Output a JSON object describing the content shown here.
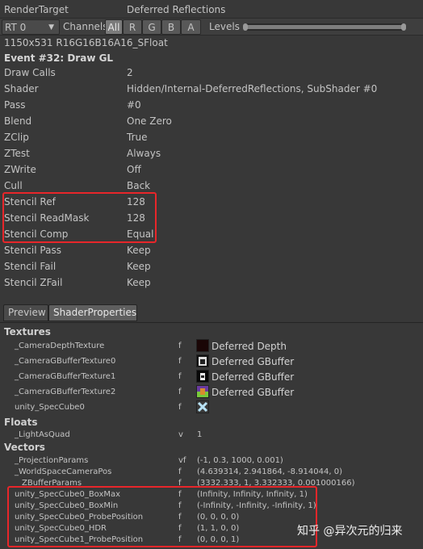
{
  "header": {
    "label": "RenderTarget",
    "value": "Deferred Reflections"
  },
  "toolbar": {
    "rt_value": "RT 0",
    "channels_label": "Channels",
    "channels": [
      "All",
      "R",
      "G",
      "B",
      "A"
    ],
    "levels_label": "Levels"
  },
  "format": "1150x531 R16G16B16A16_SFloat",
  "event_title": "Event #32: Draw GL",
  "properties": [
    {
      "label": "Draw Calls",
      "value": "2"
    },
    {
      "label": "Shader",
      "value": "Hidden/Internal-DeferredReflections, SubShader #0"
    },
    {
      "label": "Pass",
      "value": "#0"
    },
    {
      "label": "Blend",
      "value": "One Zero"
    },
    {
      "label": "ZClip",
      "value": "True"
    },
    {
      "label": "ZTest",
      "value": "Always"
    },
    {
      "label": "ZWrite",
      "value": "Off"
    },
    {
      "label": "Cull",
      "value": "Back"
    },
    {
      "label": "Stencil Ref",
      "value": "128"
    },
    {
      "label": "Stencil ReadMask",
      "value": "128"
    },
    {
      "label": "Stencil Comp",
      "value": "Equal"
    },
    {
      "label": "Stencil Pass",
      "value": "Keep"
    },
    {
      "label": "Stencil Fail",
      "value": "Keep"
    },
    {
      "label": "Stencil ZFail",
      "value": "Keep"
    }
  ],
  "tabs": [
    "Preview",
    "ShaderProperties"
  ],
  "textures_header": "Textures",
  "textures": [
    {
      "name": "_CameraDepthTexture",
      "flag": "f",
      "tex": "Deferred Depth"
    },
    {
      "name": "_CameraGBufferTexture0",
      "flag": "f",
      "tex": "Deferred GBuffer"
    },
    {
      "name": "_CameraGBufferTexture1",
      "flag": "f",
      "tex": "Deferred GBuffer"
    },
    {
      "name": "_CameraGBufferTexture2",
      "flag": "f",
      "tex": "Deferred GBuffer"
    },
    {
      "name": "unity_SpecCube0",
      "flag": "f",
      "tex": ""
    }
  ],
  "floats_header": "Floats",
  "floats": [
    {
      "name": "_LightAsQuad",
      "flag": "v",
      "value": "1"
    }
  ],
  "vectors_header": "Vectors",
  "vectors": [
    {
      "name": "_ProjectionParams",
      "flag": "vf",
      "value": "(-1, 0.3, 1000, 0.001)"
    },
    {
      "name": "_WorldSpaceCameraPos",
      "flag": "f",
      "value": "(4.639314, 2.941864, -8.914044, 0)"
    },
    {
      "name": "_ZBufferParams",
      "flag": "f",
      "value": "(3332.333, 1, 3.332333, 0.001000166)"
    },
    {
      "name": "unity_SpecCube0_BoxMax",
      "flag": "f",
      "value": "(Infinity, Infinity, Infinity, 1)"
    },
    {
      "name": "unity_SpecCube0_BoxMin",
      "flag": "f",
      "value": "(-Infinity, -Infinity, -Infinity, 1)"
    },
    {
      "name": "unity_SpecCube0_ProbePosition",
      "flag": "f",
      "value": "(0, 0, 0, 0)"
    },
    {
      "name": "unity_SpecCube0_HDR",
      "flag": "f",
      "value": "(1, 1, 0, 0)"
    },
    {
      "name": "unity_SpecCube1_ProbePosition",
      "flag": "f",
      "value": "(0, 0, 0, 1)"
    }
  ],
  "watermark": "知乎 @异次元的归来",
  "colors": {
    "highlight": "#e8262a",
    "background": "#383838",
    "text": "#c4c4c4"
  }
}
